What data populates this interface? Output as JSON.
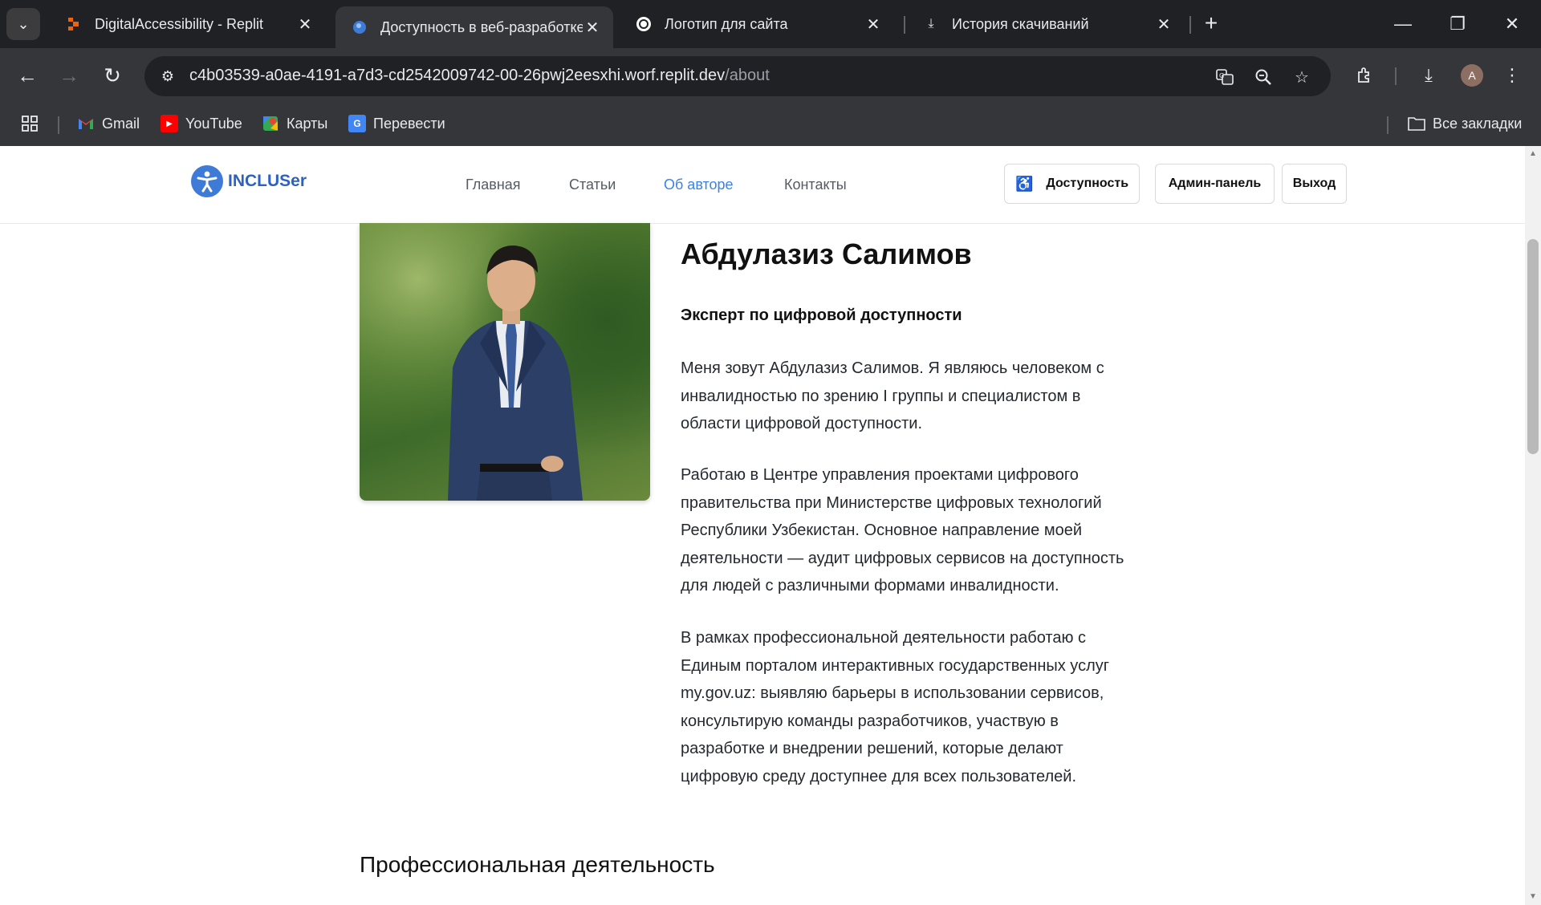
{
  "browser": {
    "tabs": [
      {
        "title": "DigitalAccessibility - Replit",
        "favicon": "replit-icon",
        "active": false
      },
      {
        "title": "Доступность в веб-разработке",
        "favicon": "globe-icon",
        "active": true
      },
      {
        "title": "Логотип для сайта",
        "favicon": "chatgpt-icon",
        "active": false
      },
      {
        "title": "История скачиваний",
        "favicon": "download-icon",
        "active": false
      }
    ],
    "address": {
      "host": "c4b03539-a0ae-4191-a7d3-cd2542009742-00-26pwj2eesxhi.worf.replit.dev",
      "path": "/about"
    },
    "profile_initial": "A",
    "bookmarks": [
      {
        "label": "Gmail",
        "icon": "gmail-icon",
        "color": "#ea4335"
      },
      {
        "label": "YouTube",
        "icon": "youtube-icon",
        "color": "#ff0000"
      },
      {
        "label": "Карты",
        "icon": "maps-icon",
        "color": "#34a853"
      },
      {
        "label": "Перевести",
        "icon": "translate-icon",
        "color": "#4285f4"
      }
    ],
    "all_bookmarks_label": "Все закладки"
  },
  "site": {
    "logo_text": "INCLUSer",
    "accent_color": "#3b82e6",
    "nav": [
      {
        "label": "Главная",
        "active": false
      },
      {
        "label": "Статьи",
        "active": false
      },
      {
        "label": "Об авторе",
        "active": true
      },
      {
        "label": "Контакты",
        "active": false
      }
    ],
    "buttons": {
      "accessibility": "Доступность",
      "admin": "Админ-панель",
      "logout": "Выход"
    }
  },
  "about": {
    "photo_alt": "Абдулазиз Салимов",
    "name": "Абдулазиз Салимов",
    "role": "Эксперт по цифровой доступности",
    "paragraphs": [
      [
        "Меня зовут Абдулазиз Салимов. Я являюсь человеком с",
        "инвалидностью по зрению I группы и специалистом в",
        "области цифровой доступности."
      ],
      [
        "Работаю в Центре управления проектами цифрового",
        "правительства при Министерстве цифровых технологий",
        "Республики Узбекистан. Основное направление моей",
        "деятельности — аудит цифровых сервисов на доступность",
        "для людей с различными формами инвалидности."
      ],
      [
        "В рамках профессиональной деятельности работаю с",
        "Единым порталом интерактивных государственных услуг",
        "my.gov.uz: выявляю барьеры в использовании сервисов,",
        "консультирую команды разработчиков, участвую в",
        "разработке и внедрении решений, которые делают",
        "цифровую среду доступнее для всех пользователей."
      ]
    ],
    "section_title": "Профессиональная деятельность"
  }
}
